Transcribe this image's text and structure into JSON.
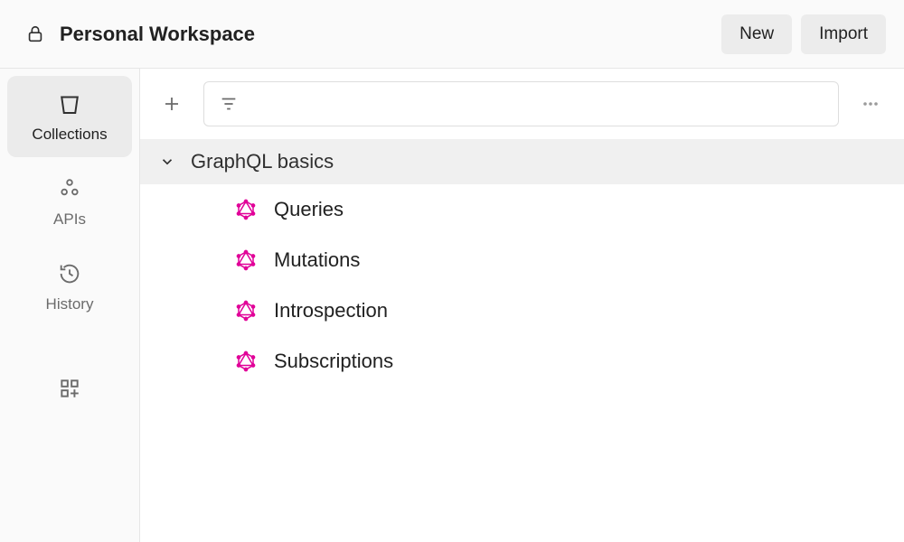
{
  "header": {
    "workspace_title": "Personal Workspace",
    "new_label": "New",
    "import_label": "Import"
  },
  "sidebar": {
    "items": [
      {
        "label": "Collections",
        "icon": "collections",
        "active": true
      },
      {
        "label": "APIs",
        "icon": "apis",
        "active": false
      },
      {
        "label": "History",
        "icon": "history",
        "active": false
      }
    ],
    "extra": {
      "icon": "more-grid"
    }
  },
  "toolbar": {
    "add_tooltip": "New",
    "search_placeholder": ""
  },
  "collection": {
    "name": "GraphQL basics",
    "expanded": true,
    "items": [
      {
        "label": "Queries",
        "type": "graphql"
      },
      {
        "label": "Mutations",
        "type": "graphql"
      },
      {
        "label": "Introspection",
        "type": "graphql"
      },
      {
        "label": "Subscriptions",
        "type": "graphql"
      }
    ]
  },
  "colors": {
    "graphql_pink": "#e10098"
  }
}
